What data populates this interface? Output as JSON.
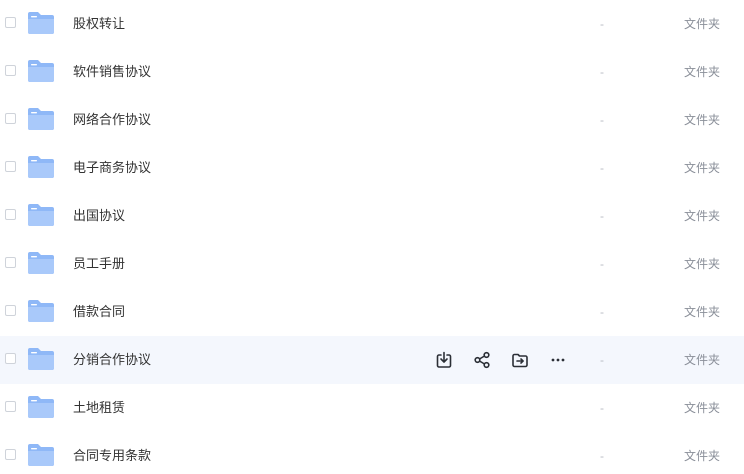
{
  "rows": [
    {
      "name": "股权转让",
      "size": "-",
      "type": "文件夹"
    },
    {
      "name": "软件销售协议",
      "size": "-",
      "type": "文件夹"
    },
    {
      "name": "网络合作协议",
      "size": "-",
      "type": "文件夹"
    },
    {
      "name": "电子商务协议",
      "size": "-",
      "type": "文件夹"
    },
    {
      "name": "出国协议",
      "size": "-",
      "type": "文件夹"
    },
    {
      "name": "员工手册",
      "size": "-",
      "type": "文件夹"
    },
    {
      "name": "借款合同",
      "size": "-",
      "type": "文件夹"
    },
    {
      "name": "分销合作协议",
      "size": "-",
      "type": "文件夹"
    },
    {
      "name": "土地租赁",
      "size": "-",
      "type": "文件夹"
    },
    {
      "name": "合同专用条款",
      "size": "-",
      "type": "文件夹"
    }
  ],
  "hover_row_index": 7,
  "row_actions": [
    {
      "icon": "download-icon"
    },
    {
      "icon": "share-icon"
    },
    {
      "icon": "move-icon"
    },
    {
      "icon": "more-icon"
    }
  ],
  "colors": {
    "folder": "#8fb8f7",
    "folder_tab": "#a9c9fa",
    "hover_bg": "#f4f7fd",
    "icon_stroke": "#2b2f36"
  }
}
